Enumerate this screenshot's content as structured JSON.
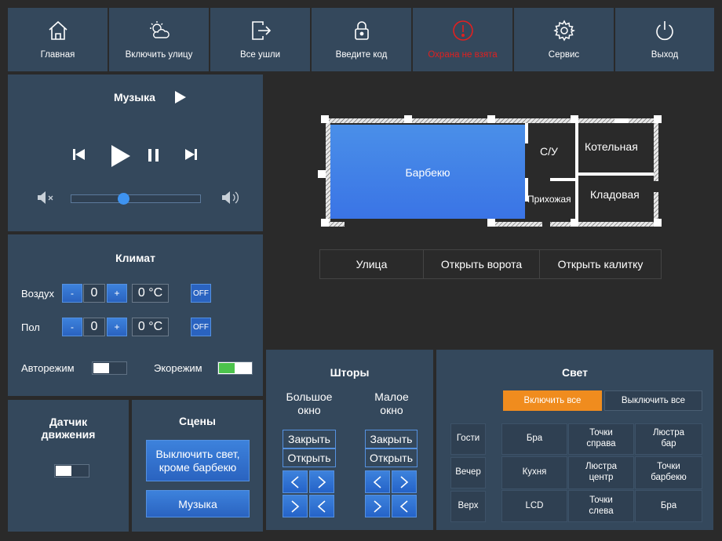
{
  "nav": [
    {
      "label": "Главная",
      "icon": "home-icon"
    },
    {
      "label": "Включить улицу",
      "icon": "weather-icon"
    },
    {
      "label": "Все ушли",
      "icon": "exit-icon"
    },
    {
      "label": "Введите код",
      "icon": "lock-icon"
    },
    {
      "label": "Охрана не взята",
      "icon": "alert-icon"
    },
    {
      "label": "Сервис",
      "icon": "gear-icon"
    },
    {
      "label": "Выход",
      "icon": "power-icon"
    }
  ],
  "music": {
    "title": "Музыка",
    "volume": 0.4
  },
  "climate": {
    "title": "Климат",
    "air": {
      "label": "Воздух",
      "minus": "-",
      "value": "0",
      "plus": "+",
      "temp": "0 °C",
      "off": "OFF"
    },
    "floor": {
      "label": "Пол",
      "minus": "-",
      "value": "0",
      "plus": "+",
      "temp": "0 °C",
      "off": "OFF"
    },
    "auto_label": "Авторежим",
    "auto_on": false,
    "eco_label": "Экорежим",
    "eco_on": true
  },
  "motion": {
    "title": "Датчик движения",
    "on": false
  },
  "scenes": {
    "title": "Сцены",
    "btn1": "Выключить свет, кроме барбекю",
    "btn2": "Музыка"
  },
  "floorplan": {
    "rooms": {
      "bbq": "Барбекю",
      "wc": "С/У",
      "boiler": "Котельная",
      "hall": "Прихожая",
      "storage": "Кладовая"
    }
  },
  "gates": [
    "Улица",
    "Открыть ворота",
    "Открыть калитку"
  ],
  "blinds": {
    "title": "Шторы",
    "big": "Большое окно",
    "small": "Малое окно",
    "close": "Закрыть",
    "open": "Открыть"
  },
  "light": {
    "title": "Свет",
    "all_on": "Включить все",
    "all_off": "Выключить все",
    "rows": [
      "Гости",
      "Вечер",
      "Верх"
    ],
    "grid": [
      [
        "Бра",
        "Точки справа",
        "Люстра бар"
      ],
      [
        "Кухня",
        "Люстра центр",
        "Точки барбекю"
      ],
      [
        "LCD",
        "Точки слева",
        "Бра"
      ]
    ]
  },
  "colors": {
    "panel": "#34485c",
    "accent": "#2a63c0",
    "orange": "#f08c1e",
    "alert": "#e02020",
    "eco_on": "#4cc34c"
  }
}
